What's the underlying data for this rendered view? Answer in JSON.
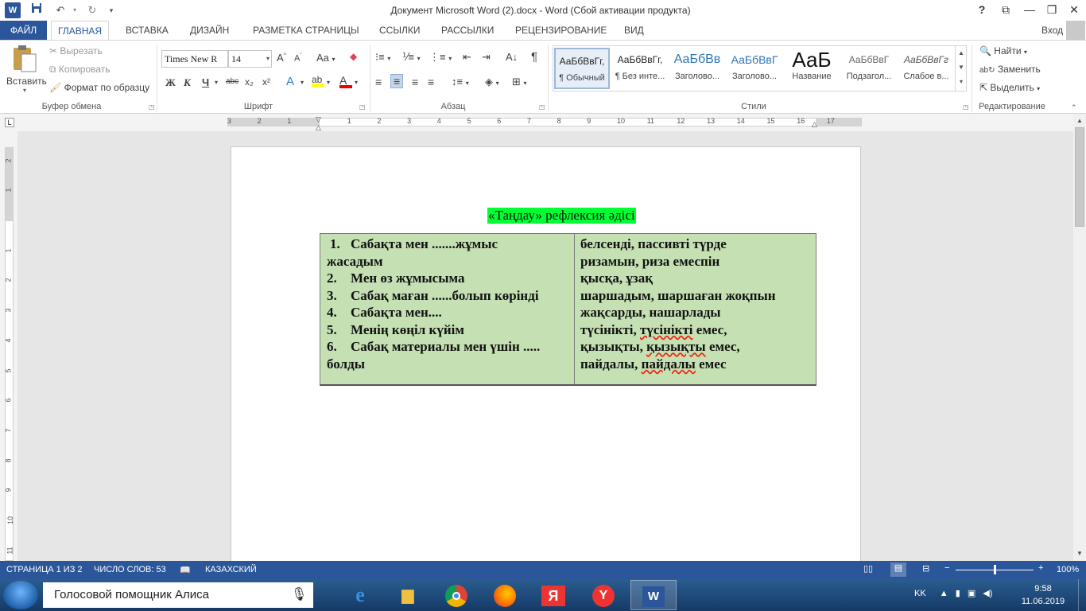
{
  "window": {
    "title": "Документ Microsoft Word (2).docx - Word (Сбой активации продукта)",
    "help": "?",
    "restore_ribbon": "⧉",
    "minimize": "—",
    "maximize": "❐",
    "close": "✕"
  },
  "quick_access": {
    "app_icon": "word-icon",
    "save_icon": "save-icon",
    "undo_icon": "undo-icon",
    "redo_icon": "redo-icon",
    "customize_icon": "customize-icon"
  },
  "tabs": [
    "ФАЙЛ",
    "ГЛАВНАЯ",
    "ВСТАВКА",
    "ДИЗАЙН",
    "РАЗМЕТКА СТРАНИЦЫ",
    "ССЫЛКИ",
    "РАССЫЛКИ",
    "РЕЦЕНЗИРОВАНИЕ",
    "ВИД"
  ],
  "signin": "Вход",
  "clipboard": {
    "paste": "Вставить",
    "cut": "Вырезать",
    "copy": "Копировать",
    "format_painter": "Формат по образцу",
    "label": "Буфер обмена"
  },
  "font": {
    "family": "Times New R",
    "size": "14",
    "grow": "A",
    "shrink": "A",
    "case": "Aa",
    "bold": "Ж",
    "italic": "К",
    "underline": "Ч",
    "strike": "abc",
    "subscript": "x₂",
    "superscript": "x²",
    "label": "Шрифт"
  },
  "paragraph": {
    "label": "Абзац",
    "pilcrow": "¶"
  },
  "styles": {
    "label": "Стили",
    "items": [
      {
        "preview": "АаБбВвГг,",
        "name": "¶ Обычный"
      },
      {
        "preview": "АаБбВвГг,",
        "name": "¶ Без инте..."
      },
      {
        "preview": "АаБбВв",
        "name": "Заголово..."
      },
      {
        "preview": "АаБбВвГ",
        "name": "Заголово..."
      },
      {
        "preview": "АаБ",
        "name": "Название"
      },
      {
        "preview": "АаБбВвГ",
        "name": "Подзагол..."
      },
      {
        "preview": "АаБбВвГг",
        "name": "Слабое в..."
      }
    ]
  },
  "editing": {
    "find": "Найти",
    "replace": "Заменить",
    "select": "Выделить",
    "label": "Редактирование"
  },
  "ruler": {
    "h_numbers": [
      "3",
      "2",
      "1",
      "1",
      "2",
      "3",
      "4",
      "5",
      "6",
      "7",
      "8",
      "9",
      "10",
      "11",
      "12",
      "13",
      "14",
      "15",
      "16",
      "17"
    ],
    "v_numbers": [
      "2",
      "1",
      "1",
      "2",
      "3",
      "4",
      "5",
      "6",
      "7",
      "8",
      "9",
      "10",
      "11"
    ]
  },
  "document": {
    "title": "«Таңдау» рефлексия әдісі",
    "left_column": [
      {
        "num": "1.",
        "text": "Сабақта мен .......жұмыс"
      },
      {
        "num": "",
        "text": "жасадым"
      },
      {
        "num": "2.",
        "text": "Мен өз жұмысыма"
      },
      {
        "num": "3.",
        "text": "Сабақ маған ......болып көрінді"
      },
      {
        "num": "4.",
        "text": "Сабақта мен...."
      },
      {
        "num": "5.",
        "text": "Менің көңіл күйім"
      },
      {
        "num": "6.",
        "text": "Сабақ материалы мен үшін ....."
      },
      {
        "num": "",
        "text": "болды"
      }
    ],
    "right_column": [
      "белсенді, пассивті түрде",
      "ризамын, риза емеспін",
      "қысқа, ұзақ",
      "шаршадым, шаршаған жоқпын",
      "жақсарды, нашарлады",
      {
        "pre": "түсінікті, ",
        "err": "түсінікті",
        "post": " емес,"
      },
      {
        "pre": "қызықты, ",
        "err": "қызықты",
        "post": " емес,"
      },
      {
        "pre": "пайдалы, ",
        "err": "пайдалы",
        "post": " емес"
      }
    ]
  },
  "statusbar": {
    "page": "СТРАНИЦА 1 ИЗ 2",
    "words": "ЧИСЛО СЛОВ: 53",
    "language": "КАЗАХСКИЙ",
    "zoom": "100%"
  },
  "taskbar": {
    "search_text": "Голосовой помощник Алиса",
    "lang": "KK",
    "time": "9:58",
    "date": "11.06.2019"
  }
}
